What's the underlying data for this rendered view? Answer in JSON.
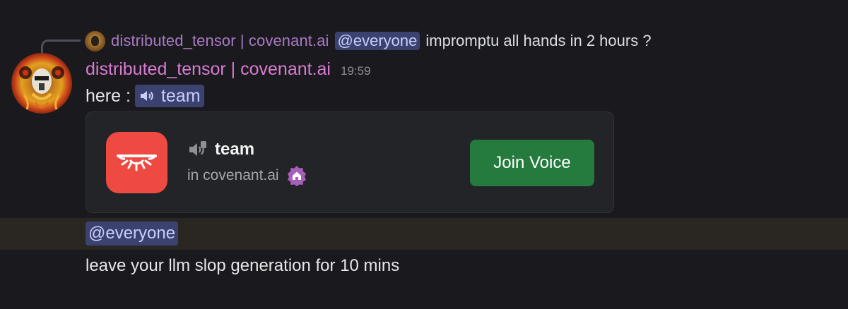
{
  "reply": {
    "author": "distributed_tensor | covenant.ai",
    "mention": "@everyone",
    "text": "impromptu all hands in 2 hours ?"
  },
  "message": {
    "author": "distributed_tensor | covenant.ai",
    "timestamp": "19:59",
    "prefix": "here :",
    "channel_mention": "team"
  },
  "embed": {
    "channel_name": "team",
    "server_line": "in covenant.ai",
    "join_label": "Join Voice"
  },
  "followup": {
    "mention": "@everyone",
    "text": "leave your llm slop generation for 10 mins"
  },
  "colors": {
    "author": "#d97bd3",
    "mention_bg": "#3c4270",
    "join_button": "#257a3e",
    "server_icon": "#ee4a42"
  },
  "icons": {
    "channel_mention": "speaker-icon",
    "embed_channel": "voice-channel-icon",
    "server_badge": "house-badge-icon"
  }
}
